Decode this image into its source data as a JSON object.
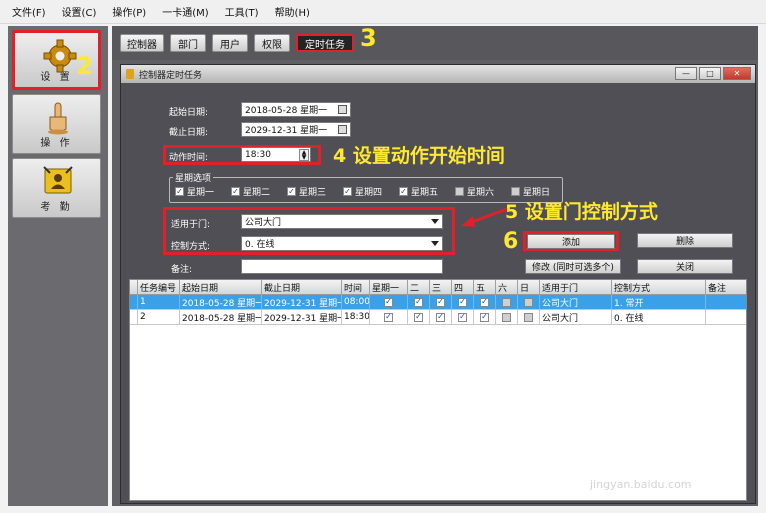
{
  "menu": [
    "文件(F)",
    "设置(C)",
    "操作(P)",
    "一卡通(M)",
    "工具(T)",
    "帮助(H)"
  ],
  "sidebar": {
    "settings_label": "设 置",
    "operate_label": "操 作",
    "attendance_label": "考 勤"
  },
  "toolbar": {
    "buttons": [
      "控制器",
      "部门",
      "用户",
      "权限",
      "定时任务"
    ],
    "active": "定时任务"
  },
  "window": {
    "title": "控制器定时任务",
    "controls": [
      "—",
      "□",
      "✕"
    ]
  },
  "form": {
    "start_date_label": "起始日期:",
    "start_date_value": "2018-05-28  星期一",
    "end_date_label": "截止日期:",
    "end_date_value": "2029-12-31  星期一",
    "action_time_label": "动作时间:",
    "action_time_value": "18:30",
    "week_group_title": "星期选项",
    "weekdays": [
      {
        "label": "星期一",
        "checked": true
      },
      {
        "label": "星期二",
        "checked": true
      },
      {
        "label": "星期三",
        "checked": true
      },
      {
        "label": "星期四",
        "checked": true
      },
      {
        "label": "星期五",
        "checked": true
      },
      {
        "label": "星期六",
        "checked": false
      },
      {
        "label": "星期日",
        "checked": false
      }
    ],
    "door_label": "适用于门:",
    "door_value": "公司大门",
    "control_label": "控制方式:",
    "control_value": "0. 在线",
    "note_label": "备注:",
    "note_value": ""
  },
  "actions": {
    "add": "添加",
    "delete": "删除",
    "modify": "修改 (同时可选多个)",
    "close": "关闭"
  },
  "annotations": {
    "a2": "2",
    "a3": "3",
    "a4": "4 设置动作开始时间",
    "a5": "5 设置门控制方式",
    "a6": "6"
  },
  "table": {
    "headers": [
      "任务编号",
      "起始日期",
      "截止日期",
      "时间",
      "星期一",
      "二",
      "三",
      "四",
      "五",
      "六",
      "日",
      "适用于门",
      "控制方式",
      "备注"
    ],
    "rows": [
      {
        "id": "1",
        "start": "2018-05-28 星期一",
        "end": "2029-12-31 星期一",
        "time": "08:00",
        "days": [
          true,
          true,
          true,
          true,
          true,
          false,
          false
        ],
        "door": "公司大门",
        "mode": "1. 常开",
        "note": ""
      },
      {
        "id": "2",
        "start": "2018-05-28 星期一",
        "end": "2029-12-31 星期一",
        "time": "18:30",
        "days": [
          true,
          true,
          true,
          true,
          true,
          false,
          false
        ],
        "door": "公司大门",
        "mode": "0. 在线",
        "note": ""
      }
    ]
  },
  "watermark": {
    "logo": "Bai du 经验",
    "url": "jingyan.baidu.com"
  },
  "colors": {
    "annotation": "#ffe830",
    "highlight": "#e0202a",
    "selection": "#3aa0e8"
  }
}
